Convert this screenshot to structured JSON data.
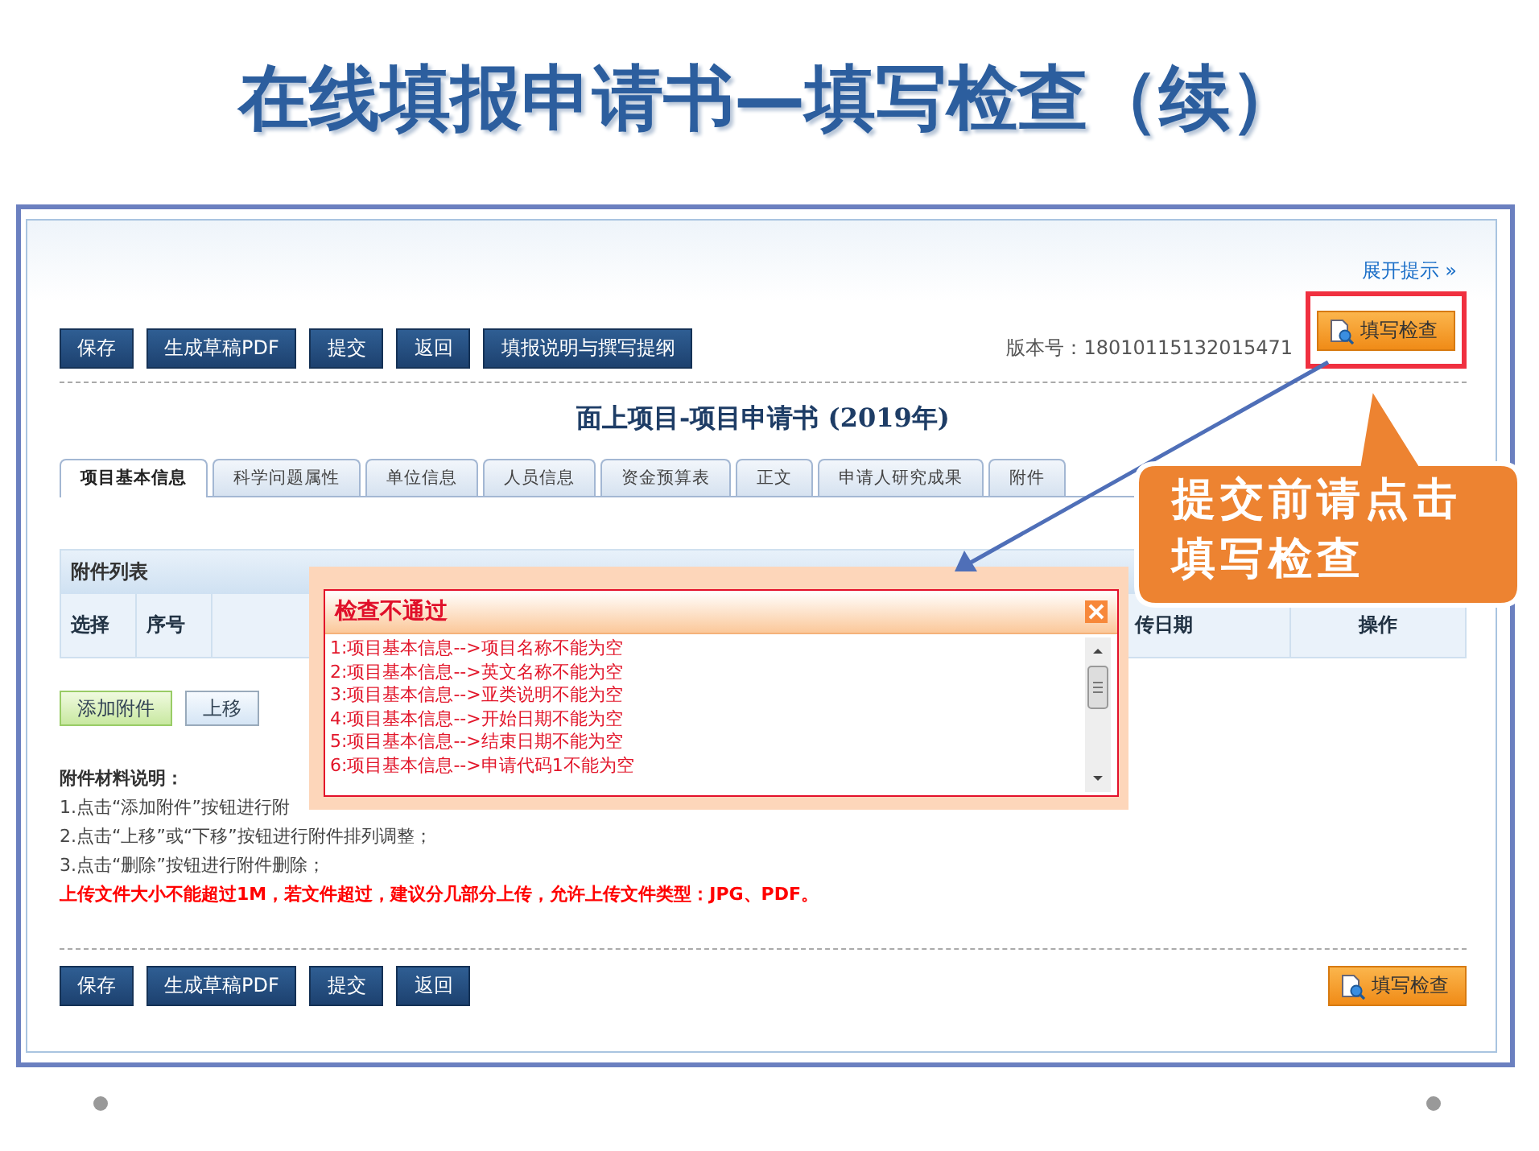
{
  "slide_title": "在线填报申请书—填写检查（续）",
  "expand_hint": "展开提示 »",
  "toolbar_buttons": [
    "保存",
    "生成草稿PDF",
    "提交",
    "返回",
    "填报说明与撰写提纲"
  ],
  "version": "版本号：18010115132015471",
  "check_button": "填写检查",
  "form_title": "面上项目-项目申请书 (2019年)",
  "tabs": [
    {
      "label": "项目基本信息",
      "selected": true
    },
    {
      "label": "科学问题属性",
      "selected": false
    },
    {
      "label": "单位信息",
      "selected": false
    },
    {
      "label": "人员信息",
      "selected": false
    },
    {
      "label": "资金预算表",
      "selected": false
    },
    {
      "label": "正文",
      "selected": false
    },
    {
      "label": "申请人研究成果",
      "selected": false
    },
    {
      "label": "附件",
      "selected": false
    }
  ],
  "attachment_panel": {
    "title": "附件列表",
    "columns": [
      "选择",
      "序号",
      "传日期",
      "操作"
    ]
  },
  "attachment_buttons": [
    {
      "label": "添加附件",
      "kind": "add"
    },
    {
      "label": "上移",
      "kind": "plain"
    }
  ],
  "notes": {
    "title": "附件材料说明：",
    "lines": [
      "1.点击“添加附件”按钮进行附",
      "2.点击“上移”或“下移”按钮进行附件排列调整；",
      "3.点击“删除”按钮进行附件删除；"
    ],
    "warning": "上传文件大小不能超过1M，若文件超过，建议分几部分上传，允许上传文件类型：JPG、PDF。"
  },
  "bottom_buttons": [
    "保存",
    "生成草稿PDF",
    "提交",
    "返回"
  ],
  "bottom_check_button": "填写检查",
  "popup": {
    "title": "检查不通过",
    "messages": [
      "1:项目基本信息-->项目名称不能为空",
      "2:项目基本信息-->英文名称不能为空",
      "3:项目基本信息-->亚类说明不能为空",
      "4:项目基本信息-->开始日期不能为空",
      "5:项目基本信息-->结束日期不能为空",
      "6:项目基本信息-->申请代码1不能为空"
    ]
  },
  "callout": "提交前请点击填写检查"
}
